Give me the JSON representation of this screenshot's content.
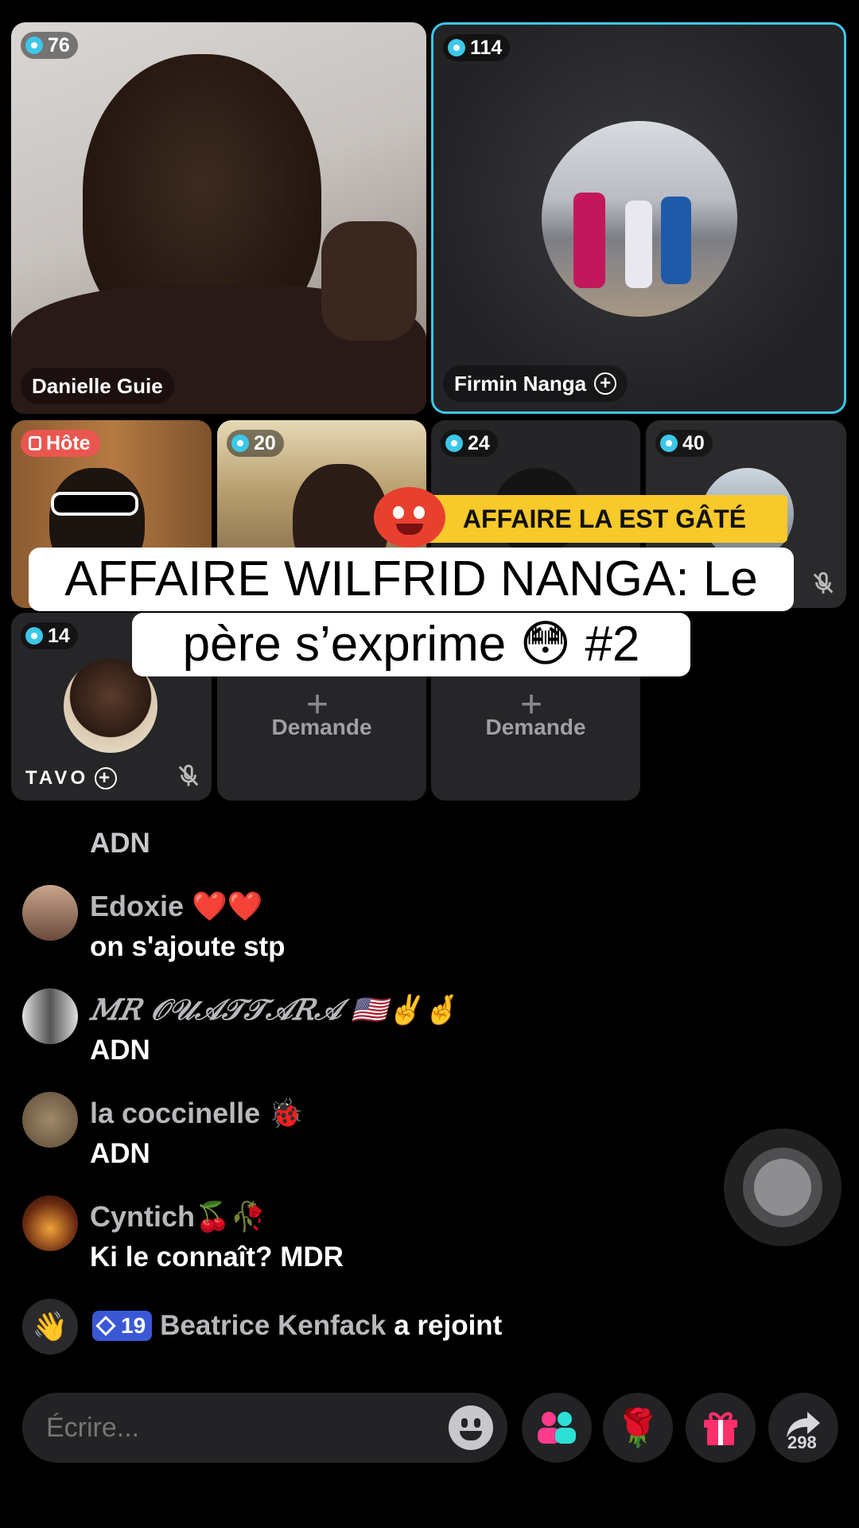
{
  "participants": [
    {
      "viewers": "76",
      "name": "Danielle Guie"
    },
    {
      "viewers": "114",
      "name": "Firmin Nanga"
    },
    {
      "role": "Hôte"
    },
    {
      "viewers": "20"
    },
    {
      "viewers": "24"
    },
    {
      "viewers": "40"
    },
    {
      "viewers": "14",
      "name": "TAVO"
    }
  ],
  "request_slots": [
    "Demande",
    "Demande"
  ],
  "overlay": {
    "sticker_text": "AFFAIRE LA EST GÂTÉ",
    "title_line1": "AFFAIRE WILFRID NANGA: Le",
    "title_line2": "père s’exprime 😳 #2"
  },
  "chat": [
    {
      "user": "",
      "message": "ADN"
    },
    {
      "user": "Edoxie ❤️❤️",
      "message": "on s'ajoute stp"
    },
    {
      "user": "𝑀𝑅 𝒪𝒰𝒜𝒯𝒯𝒜𝑅𝒜 🇺🇸✌️🤞",
      "message": "ADN"
    },
    {
      "user": "la coccinelle 🐞",
      "message": "ADN"
    },
    {
      "user": "Cyntich🍒🥀",
      "message": "Ki le connaît? MDR"
    }
  ],
  "join_event": {
    "level": "19",
    "user": "Beatrice Kenfack",
    "action": "a rejoint"
  },
  "composer": {
    "placeholder": "Écrire..."
  },
  "share_count": "298",
  "colors": {
    "accent_cyan": "#3cc7e8",
    "host_red": "#e9564f",
    "sticker_yellow": "#f7c92a",
    "level_badge": "#3a57d6"
  }
}
